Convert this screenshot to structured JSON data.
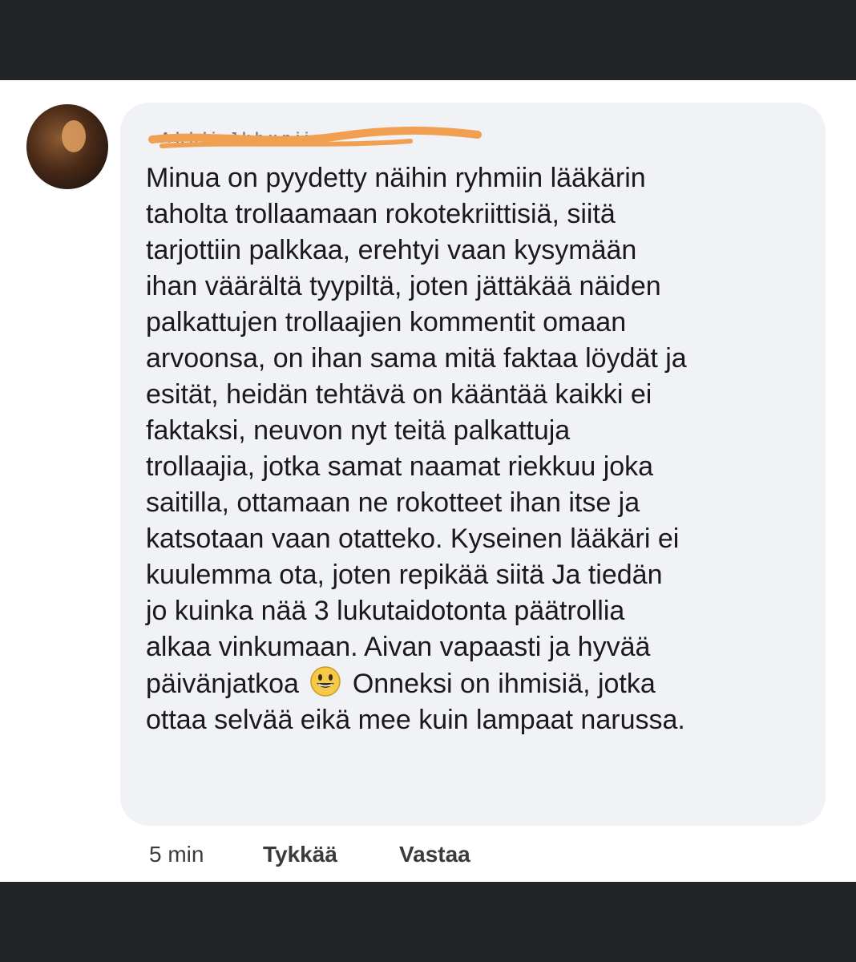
{
  "comment": {
    "author_name": "Ahhli Jkhunjin",
    "lines": [
      "Minua on pyydetty näihin ryhmiin lääkärin",
      "taholta trollaamaan rokotekriittisiä, siitä",
      "tarjottiin palkkaa, erehtyi vaan kysymään",
      "ihan väärältä tyypiltä, joten jättäkää näiden",
      "palkattujen trollaajien kommentit omaan",
      "arvoonsa, on ihan sama mitä faktaa löydät ja",
      "esität, heidän tehtävä on kääntää kaikki ei",
      "faktaksi, neuvon nyt teitä palkattuja",
      "trollaajia, jotka samat naamat riekkuu joka",
      "saitilla, ottamaan ne rokotteet ihan itse ja",
      "katsotaan vaan otatteko. Kyseinen lääkäri ei",
      "kuulemma ota, joten repikää siitä Ja tiedän",
      "jo kuinka nää 3 lukutaidotonta päätrollia",
      "alkaa vinkumaan. Aivan vapaasti ja hyvää"
    ],
    "line15_before": "päivänjatkoa",
    "line15_after": "Onneksi on ihmisiä, jotka",
    "line16": "ottaa selvää eikä mee kuin lampaat narussa.",
    "emoji_icon": "grinning-face-icon"
  },
  "actions": {
    "time": "5 min",
    "like": "Tykkää",
    "reply": "Vastaa"
  },
  "colors": {
    "frame_bar": "#222426",
    "bubble_bg": "#f0f2f5",
    "redaction": "#f0a050"
  }
}
